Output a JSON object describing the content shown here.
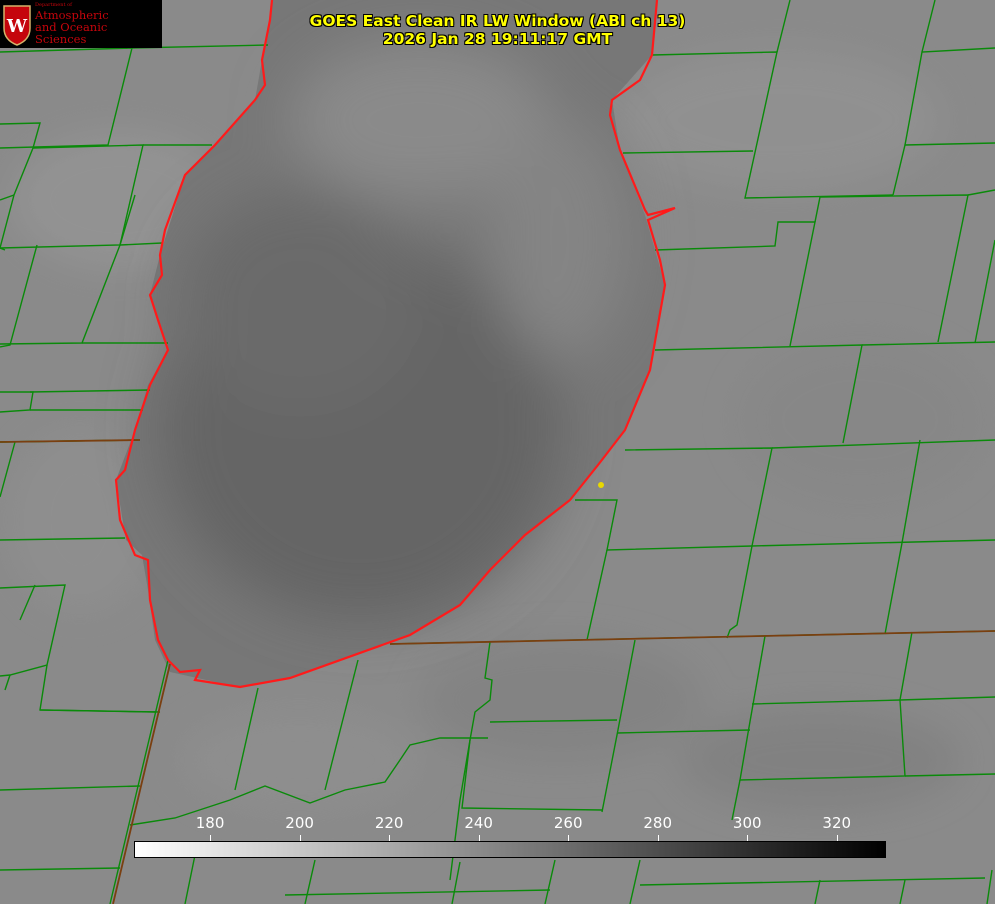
{
  "title": {
    "line1": "GOES East Clean IR LW Window (ABI ch 13)",
    "line2": "2026 Jan 28 19:11:17 GMT",
    "color": "#ffff00"
  },
  "logo": {
    "icon": "uw-crest-icon",
    "crest_letter": "W",
    "department": "Department of",
    "line1": "Atmospheric",
    "line2": "and Oceanic Sciences",
    "color": "#c5050c"
  },
  "map": {
    "feature": "lake-michigan-southern-basin",
    "coastline_color": "#ff1a1a",
    "boundary_color": "#0a8a0a",
    "background_tone": "#8c8c8c",
    "lake_tone": "#6a6a6a",
    "marker_color": "#e8d800"
  },
  "colorbar": {
    "ticks": [
      "180",
      "200",
      "220",
      "240",
      "260",
      "280",
      "300",
      "320"
    ],
    "tick_values": [
      180,
      200,
      220,
      240,
      260,
      280,
      300,
      320
    ],
    "min": 163,
    "max": 331,
    "from_color": "#ffffff",
    "to_color": "#000000"
  }
}
